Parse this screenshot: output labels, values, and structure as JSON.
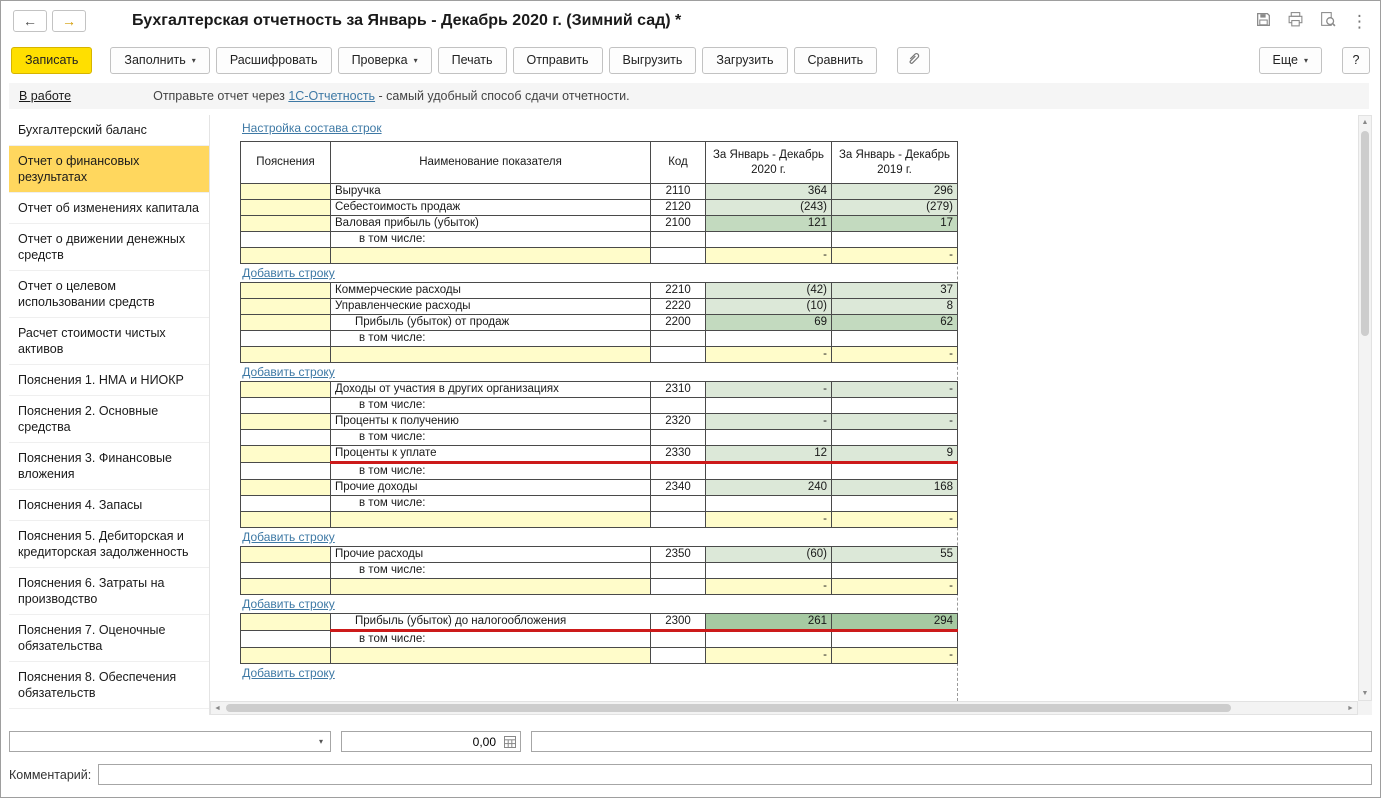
{
  "window": {
    "title": "Бухгалтерская отчетность за Январь - Декабрь 2020 г. (Зимний сад) *"
  },
  "icons": {
    "back_arrow": "←",
    "forward_arrow": "→",
    "caret_down": "▾",
    "kebab": "⋮",
    "plus": "+",
    "scroll_up": "▲",
    "scroll_down": "▼",
    "scroll_left": "◄",
    "scroll_right": "►",
    "help": "?"
  },
  "toolbar": {
    "save": "Записать",
    "fill": "Заполнить",
    "decipher": "Расшифровать",
    "check": "Проверка",
    "print": "Печать",
    "send": "Отправить",
    "export": "Выгрузить",
    "load": "Загрузить",
    "compare": "Сравнить",
    "more": "Еще"
  },
  "statusbar": {
    "state": "В работе",
    "message_before": "Отправьте отчет через ",
    "service_link": "1С-Отчетность",
    "message_after": " - самый удобный способ сдачи отчетности."
  },
  "sidebar": {
    "items": [
      {
        "label": "Бухгалтерский баланс",
        "selected": false
      },
      {
        "label": "Отчет о финансовых результатах",
        "selected": true
      },
      {
        "label": "Отчет об изменениях капитала",
        "selected": false
      },
      {
        "label": "Отчет о движении денежных средств",
        "selected": false
      },
      {
        "label": "Отчет о целевом использовании средств",
        "selected": false
      },
      {
        "label": "Расчет стоимости чистых активов",
        "selected": false
      },
      {
        "label": "Пояснения 1. НМА и НИОКР",
        "selected": false
      },
      {
        "label": "Пояснения 2. Основные средства",
        "selected": false
      },
      {
        "label": "Пояснения 3. Финансовые вложения",
        "selected": false
      },
      {
        "label": "Пояснения 4. Запасы",
        "selected": false
      },
      {
        "label": "Пояснения 5. Дебиторская и кредиторская задолженность",
        "selected": false
      },
      {
        "label": "Пояснения 6. Затраты на производство",
        "selected": false
      },
      {
        "label": "Пояснения 7. Оценочные обязательства",
        "selected": false
      },
      {
        "label": "Пояснения 8. Обеспечения обязательств",
        "selected": false
      }
    ]
  },
  "main": {
    "settings_link": "Настройка состава строк",
    "add_row_label": "Добавить строку",
    "table": {
      "including_label": "в том числе:",
      "headers": {
        "notes": "Пояснения",
        "name": "Наименование показателя",
        "code": "Код",
        "period_2020": "За Январь - Декабрь 2020 г.",
        "period_2019": "За Январь - Декабрь 2019 г."
      },
      "groups": [
        {
          "rows": [
            {
              "type": "data",
              "name": "Выручка",
              "code": "2110",
              "v1": "364",
              "v2": "296"
            },
            {
              "type": "data",
              "name": "Себестоимость продаж",
              "code": "2120",
              "v1": "(243)",
              "v2": "(279)"
            },
            {
              "type": "total",
              "name": "Валовая прибыль (убыток)",
              "code": "2100",
              "v1": "121",
              "v2": "17"
            },
            {
              "type": "including"
            },
            {
              "type": "empty",
              "v1": "-",
              "v2": "-"
            }
          ]
        },
        {
          "rows": [
            {
              "type": "data",
              "name": "Коммерческие расходы",
              "code": "2210",
              "v1": "(42)",
              "v2": "37"
            },
            {
              "type": "data",
              "name": "Управленческие расходы",
              "code": "2220",
              "v1": "(10)",
              "v2": "8"
            },
            {
              "type": "total",
              "name": "Прибыль (убыток) от продаж",
              "code": "2200",
              "v1": "69",
              "v2": "62",
              "indent": true
            },
            {
              "type": "including"
            },
            {
              "type": "empty",
              "v1": "-",
              "v2": "-"
            }
          ]
        },
        {
          "rows": [
            {
              "type": "data",
              "name": "Доходы от участия в других организациях",
              "code": "2310",
              "v1": "-",
              "v2": "-"
            },
            {
              "type": "including"
            },
            {
              "type": "data",
              "name": "Проценты к получению",
              "code": "2320",
              "v1": "-",
              "v2": "-"
            },
            {
              "type": "including"
            },
            {
              "type": "data",
              "name": "Проценты к уплате",
              "code": "2330",
              "v1": "12",
              "v2": "9",
              "redline": true
            },
            {
              "type": "including"
            },
            {
              "type": "data",
              "name": "Прочие доходы",
              "code": "2340",
              "v1": "240",
              "v2": "168"
            },
            {
              "type": "including"
            },
            {
              "type": "empty",
              "v1": "-",
              "v2": "-"
            }
          ]
        },
        {
          "rows": [
            {
              "type": "data",
              "name": "Прочие расходы",
              "code": "2350",
              "v1": "(60)",
              "v2": "55"
            },
            {
              "type": "including"
            },
            {
              "type": "empty",
              "v1": "-",
              "v2": "-"
            }
          ]
        },
        {
          "rows": [
            {
              "type": "total",
              "name": "Прибыль (убыток) до налогообложения",
              "code": "2300",
              "v1": "261",
              "v2": "294",
              "indent": true,
              "redline": true,
              "emphasis": true
            },
            {
              "type": "including"
            },
            {
              "type": "empty",
              "v1": "-",
              "v2": "-"
            }
          ]
        }
      ]
    }
  },
  "footer": {
    "amount": "0,00",
    "comment_label": "Комментарий:"
  },
  "colors": {
    "accent_yellow": "#ffdf00",
    "selected_item": "#ffd75e",
    "cell_yellow": "#fffcca",
    "cell_green": "#dce8d8",
    "cell_green_total": "#c3dabf",
    "cell_green_emphasis": "#a6c9a2",
    "red_line": "#cc1a1a",
    "link": "#3e79a5"
  }
}
